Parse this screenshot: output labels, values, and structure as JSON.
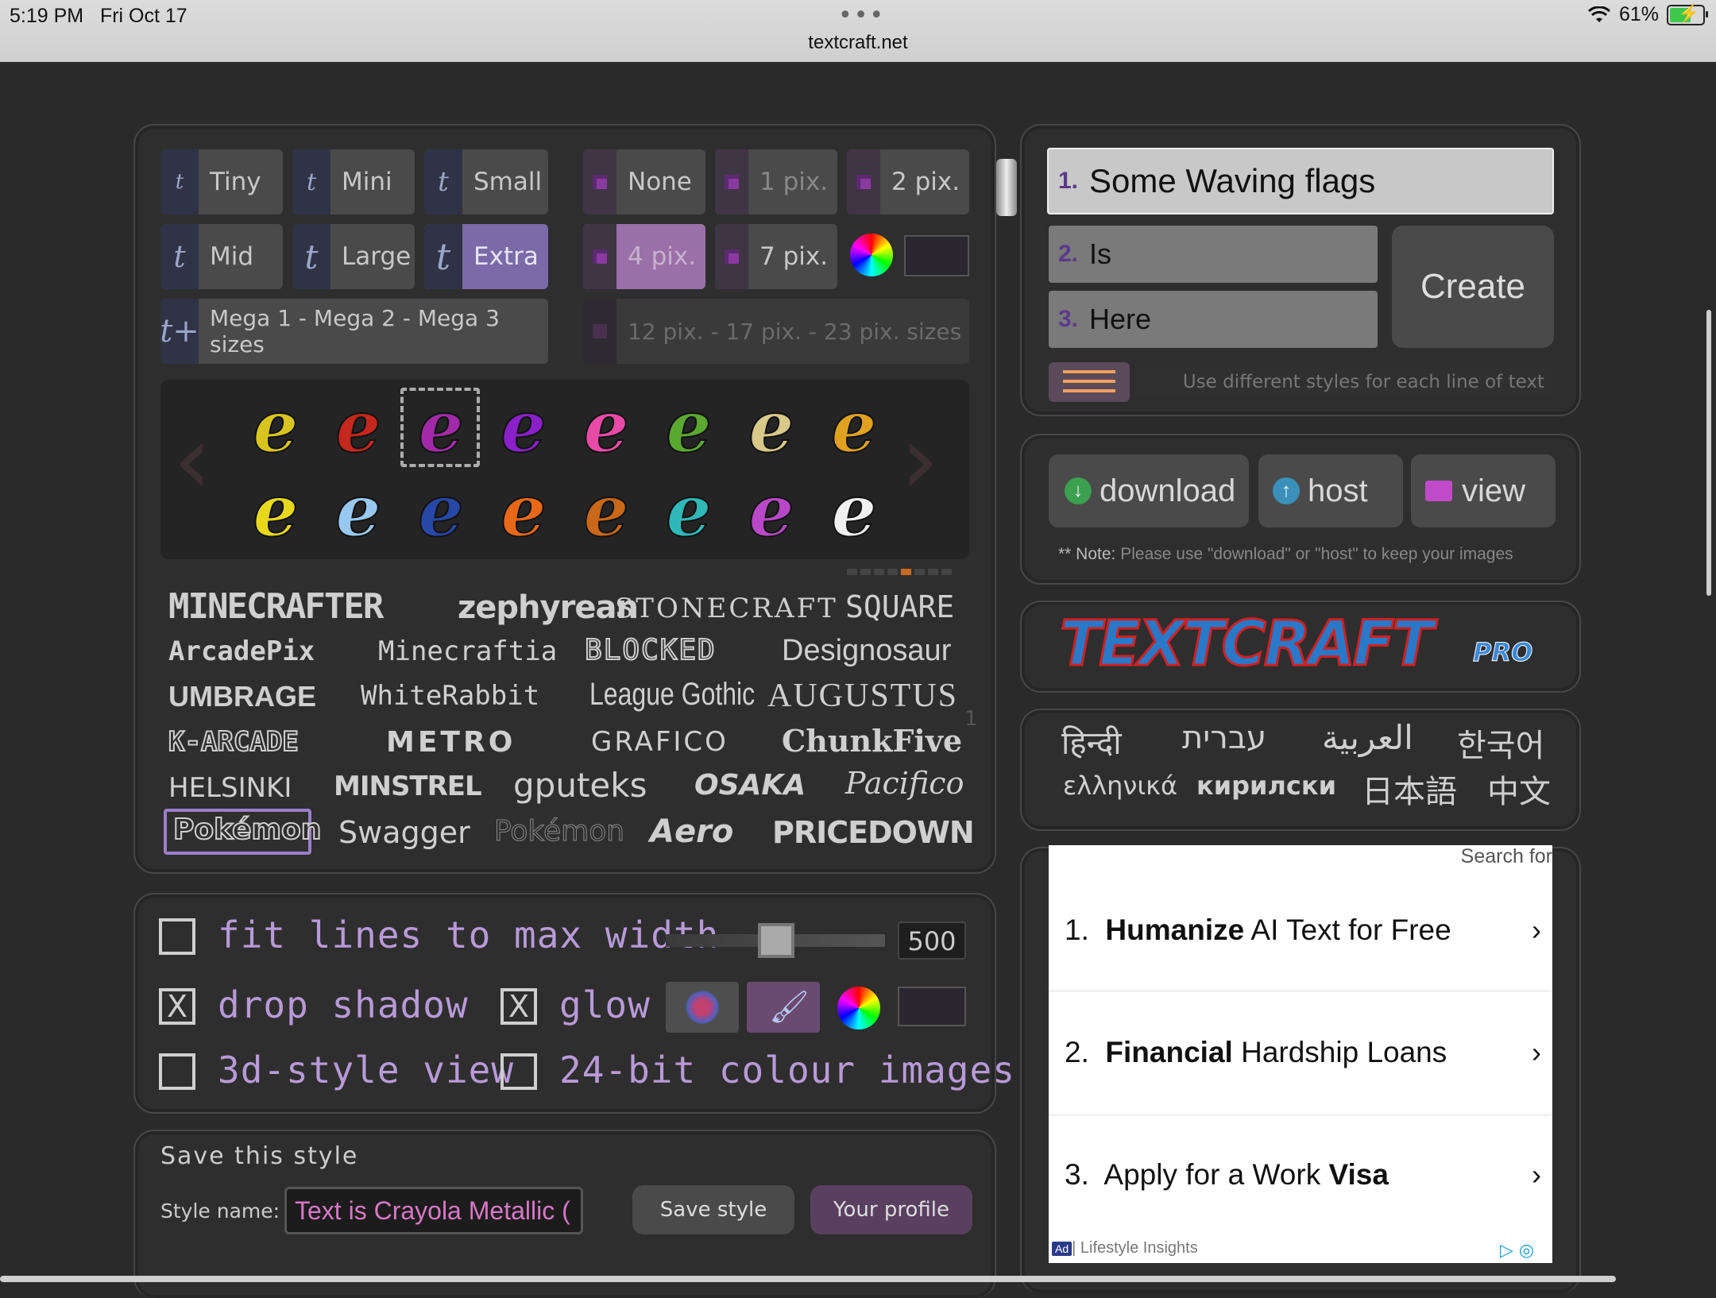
{
  "status_bar": {
    "time": "5:19 PM",
    "date": "Fri Oct 17",
    "dots": "•••",
    "url": "textcraft.net",
    "battery": "61%"
  },
  "sizes": {
    "buttons": [
      {
        "icon": "t",
        "label": "Tiny"
      },
      {
        "icon": "t",
        "label": "Mini"
      },
      {
        "icon": "t",
        "label": "Small"
      },
      {
        "icon": "t",
        "label": "Mid"
      },
      {
        "icon": "t",
        "label": "Large"
      },
      {
        "icon": "t",
        "label": "Extra"
      }
    ],
    "mega": {
      "icon": "t+",
      "label": "Mega 1 - Mega 2 - Mega 3 sizes"
    }
  },
  "outline": {
    "buttons": [
      "None",
      "1 pix.",
      "2 pix.",
      "4 pix.",
      "7 pix."
    ],
    "large": "12 pix. - 17 pix. - 23 pix. sizes"
  },
  "styles": {
    "prev": "‹",
    "next": "›",
    "glyph": "e",
    "row1_colors": [
      "#d8c41c",
      "#c4281c",
      "#a22aa8",
      "#8a20c8",
      "#e84aa8",
      "#5aa830",
      "#d8c88a",
      "#e0a020"
    ],
    "row2_colors": [
      "#e8d81c",
      "#98c8f0",
      "#2848a8",
      "#e86818",
      "#c86818",
      "#30b8b8",
      "#b848c8",
      "#f0f0f0"
    ]
  },
  "fonts": {
    "rows": [
      [
        "MINECRAFTER",
        "zephyrean",
        "STONECRAFT",
        "SQUARE"
      ],
      [
        "ArcadePix",
        "Minecraftia",
        "BLOCKED",
        "Designosaur"
      ],
      [
        "UMBRAGE",
        "WhiteRabbit",
        "League Gothic",
        "AUGUSTUS"
      ],
      [
        "K-ARCADE",
        "METRO",
        "GRAFICO",
        "ChunkFive"
      ],
      [
        "HELSINKI",
        "MINSTREL",
        "gputeks",
        "OSAKA",
        "Pacifico"
      ],
      [
        "Pokémon",
        "Swagger",
        "Pokémon",
        "Aero",
        "PRICEDOWN"
      ]
    ],
    "page_marker": "1"
  },
  "options": {
    "fit_lines": "fit lines to max width",
    "width_value": "500",
    "drop_shadow": "drop shadow",
    "glow": "glow",
    "three_d": "3d-style view",
    "colour24": "24-bit colour images",
    "check_mark": "X"
  },
  "save": {
    "title": "Save this style",
    "name_label": "Style name:",
    "name_value": "Text is Crayola Metallic (",
    "save_button": "Save style",
    "profile_button": "Your profile"
  },
  "text_lines": {
    "line1": {
      "num": "1.",
      "value": "Some Waving flags"
    },
    "line2": {
      "num": "2.",
      "value": "Is"
    },
    "line3": {
      "num": "3.",
      "value": "Here"
    },
    "create": "Create",
    "multi_style_hint": "Use different styles for each line of text"
  },
  "output": {
    "download": "download",
    "host": "host",
    "view": "view",
    "note_prefix": "** Note:",
    "note": "Please use \"download\" or \"host\" to keep your images"
  },
  "logo": {
    "main": "TEXTCRAFT",
    "pro": "PRO"
  },
  "languages": {
    "row1": [
      "हिन्दी",
      "עברית",
      "العربية",
      "한국어"
    ],
    "row2": [
      "ελληνικά",
      "кирилски",
      "日本語",
      "中文"
    ]
  },
  "ad": {
    "search_for": "Search for",
    "items": [
      {
        "num": "1.",
        "bold": "Humanize",
        "rest": " AI Text for Free"
      },
      {
        "num": "2.",
        "bold": "Financial",
        "rest": " Hardship Loans"
      },
      {
        "num": "3.",
        "pre": "Apply for a Work ",
        "bold": "Visa"
      }
    ],
    "chevron": "›",
    "badge": "Ad",
    "sponsor": "| Lifestyle Insights"
  }
}
